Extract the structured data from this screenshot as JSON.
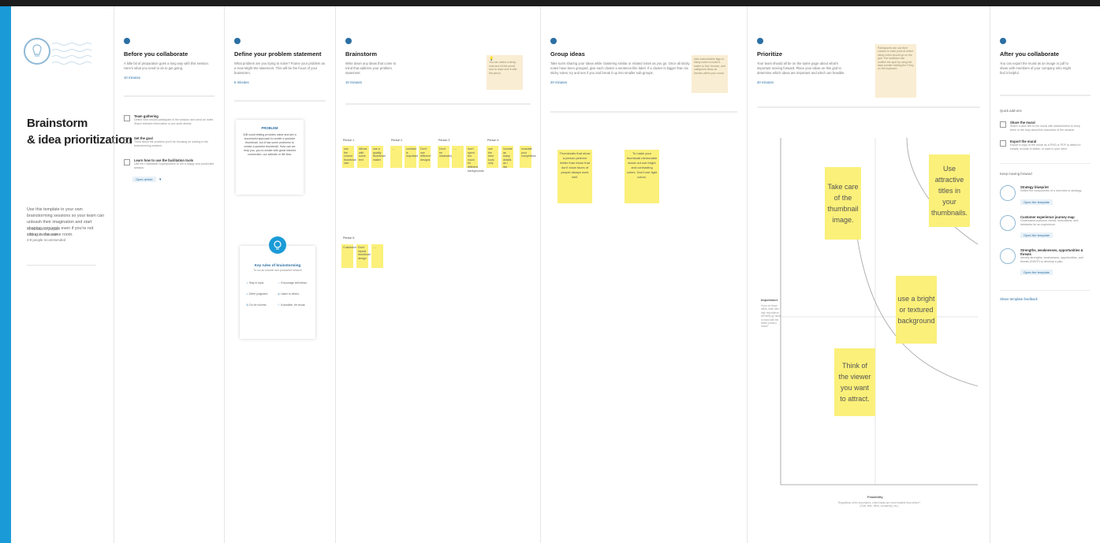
{
  "intro": {
    "title_line1": "Brainstorm",
    "title_line2": "& idea prioritization",
    "description": "Use this template in your own brainstorming sessions so your team can unleash their imagination and start shaping concepts even if you're not sitting in the same room.",
    "meta": [
      "72 minutes to prepare",
      "1 hour to collaborate",
      "2-8 people recommended"
    ]
  },
  "steps": [
    {
      "title": "Before you collaborate",
      "body": "A little bit of preparation goes a long way with this session. Here's what you need to do to get going.",
      "time": "10 minutes"
    },
    {
      "title": "Define your problem statement",
      "body": "What problem are you trying to solve? Frame your problem as a How Might We statement. This will be the focus of your brainstorm.",
      "time": "5 minutes"
    },
    {
      "title": "Brainstorm",
      "body": "Write down any ideas that come to mind that address your problem statement.",
      "time": "10 minutes"
    },
    {
      "title": "Group ideas",
      "body": "Take turns sharing your ideas while clustering similar or related notes as you go. Once all sticky notes have been grouped, give each cluster a sentence-like label. If a cluster is bigger than six sticky notes, try and see if you and break it up into smaller sub-groups.",
      "time": "20 minutes"
    },
    {
      "title": "Prioritize",
      "body": "Your team should all be on the same page about what's important moving forward. Place your ideas on this grid to determine which ideas are important and which are feasible.",
      "time": "20 minutes"
    },
    {
      "title": "After you collaborate",
      "body": "You can export the mural as an image or pdf to share with members of your company who might find it helpful."
    }
  ],
  "checklist": [
    {
      "title": "Team gathering",
      "desc": "Define who should participate in the session and send an invite. Share relevant information or pre-work ahead."
    },
    {
      "title": "Set the goal",
      "desc": "Think about the problem you'll be focusing on solving in the brainstorming session."
    },
    {
      "title": "Learn how to use the facilitation tools",
      "desc": "Use the Facilitation Superpowers to run a happy and productive session."
    }
  ],
  "open_article": "Open article",
  "problem_card": {
    "heading": "PROBLEM",
    "text": "A/B could testing provides value and are a successful approach to create a youtube thumbnail, but it has some problems to create a youtube thumbnail. How can we help you, you to create with great interest connection, our website or life flow."
  },
  "rules_card": {
    "title": "Key rules of brainstorming",
    "subtitle": "To run an smooth and productive session",
    "rules": [
      "Stay in topic.",
      "Encourage wild ideas.",
      "Defer judgment.",
      "Listen to others.",
      "Go for volume.",
      "If possible, be visual."
    ]
  },
  "hints": {
    "brainstorm": "You can select a sticky note and hit the pencil icon to draw over it with the pencil.",
    "group": "Add customizable tags to sticky notes to make it easier to find, browse, and categorize ideas as themes within your mural.",
    "prioritize": "Participants can use their cursors to each point at where sticky notes should go on the grid. The facilitator can confirm the spot by using the laser pointer holding the H key on the keyboard."
  },
  "personas": [
    "Person 1",
    "Person 2",
    "Person 3",
    "Person 4",
    "Person 5"
  ],
  "brainstorm_notes": {
    "p1": [
      "use the correct thumbnail size",
      "Attract with some text",
      "use a quality thumbnail maker"
    ],
    "p2": [
      "....",
      "contrast is important",
      "Don't use different designs"
    ],
    "p3": [
      "Don't be misleading",
      "....",
      "don't spent too much for different backgrounds"
    ],
    "p4": [
      "use the best tools only",
      "Include as many details as I like",
      "evaluate your competitors"
    ],
    "p5": [
      "Customizing",
      "Don't repeat thumbnail design",
      "...."
    ]
  },
  "group_notes": [
    "Thumbnails that show a person perform better than those that don't show faces of people always work well.",
    "To make your thumbnail memorable stand out use bright and contrasting colors. Don't use tight colors."
  ],
  "prioritize_notes": [
    "Take care of the thumbnail image.",
    "Use attractive titles in your thumbnails.",
    "use a bright or textured background",
    "Think of the viewer you want to attract."
  ],
  "axes": {
    "y_label": "Importance",
    "y_desc": "If you do these ideas, each with high importance, will likely go hand in hand with the better product result?",
    "x_label": "Feasibility",
    "x_desc": "Regardless of the importance, which tasks are more feasible than others? (Cost, time, effort, complexity, etc.)"
  },
  "after": {
    "quick_add_ons": "Quick add-ons",
    "share_title": "Share the mural",
    "share_desc": "Share a view link to the mural with stakeholders to keep them in the loop about the outcomes of the session.",
    "export_title": "Export the mural",
    "export_desc": "Export a copy of the mural as a PNG or PDF to attach in emails, include in slides, or save in your drive.",
    "keep_moving": "Keep moving forward",
    "templates": [
      {
        "title": "Strategy blueprint",
        "desc": "Define the components of a new idea or strategy.",
        "button": "Open the template"
      },
      {
        "title": "Customer experience journey map",
        "desc": "Understand customer needs, motivations, and obstacles for an experience.",
        "button": "Open the template"
      },
      {
        "title": "Strengths, weaknesses, opportunities & threats",
        "desc": "Identify strengths, weaknesses, opportunities, and threats (SWOT) to develop a plan.",
        "button": "Open the template"
      }
    ],
    "feedback": "Share template feedback"
  },
  "colors": {
    "accent": "#1a9bd7",
    "sticky": "#fbf07a",
    "hint": "#f9edd3",
    "dot": "#2b6fa3"
  }
}
